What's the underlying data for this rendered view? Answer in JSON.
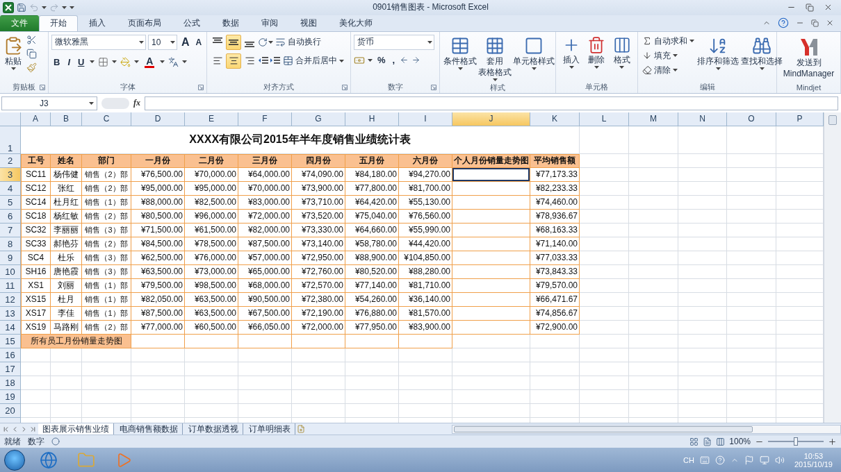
{
  "window": {
    "title": "0901销售图表 - Microsoft Excel"
  },
  "ribbon_tabs": [
    {
      "label": "文件",
      "kind": "file",
      "selected": false
    },
    {
      "label": "开始",
      "kind": "tab",
      "selected": true
    },
    {
      "label": "插入",
      "kind": "tab",
      "selected": false
    },
    {
      "label": "页面布局",
      "kind": "tab",
      "selected": false
    },
    {
      "label": "公式",
      "kind": "tab",
      "selected": false
    },
    {
      "label": "数据",
      "kind": "tab",
      "selected": false
    },
    {
      "label": "审阅",
      "kind": "tab",
      "selected": false
    },
    {
      "label": "视图",
      "kind": "tab",
      "selected": false
    },
    {
      "label": "美化大师",
      "kind": "tab",
      "selected": false
    }
  ],
  "ribbon": {
    "clipboard": {
      "label": "剪贴板",
      "paste": "粘贴"
    },
    "font": {
      "label": "字体",
      "font_name": "微软雅黑",
      "font_size": "10",
      "grow": "A",
      "shrink": "A",
      "bold": "B",
      "italic": "I",
      "underline": "U",
      "font_color": "A"
    },
    "alignment": {
      "label": "对齐方式",
      "vertical": [
        {
          "selected": false
        },
        {
          "selected": true
        },
        {
          "selected": false
        }
      ],
      "horizontal": [
        {
          "selected": false
        },
        {
          "selected": true
        },
        {
          "selected": false
        }
      ],
      "wrap_text": "自动换行",
      "merge_center": "合并后居中"
    },
    "number": {
      "label": "数字",
      "format": "货币",
      "percent": "%",
      "comma": ","
    },
    "styles": {
      "label": "样式",
      "buttons": [
        {
          "lines": [
            "条件格式"
          ]
        },
        {
          "lines": [
            "套用",
            "表格格式"
          ]
        },
        {
          "lines": [
            "单元格样式"
          ]
        }
      ]
    },
    "cells": {
      "label": "单元格",
      "buttons": [
        {
          "lines": [
            "插入"
          ]
        },
        {
          "lines": [
            "删除"
          ]
        },
        {
          "lines": [
            "格式"
          ]
        }
      ]
    },
    "editing": {
      "label": "编辑",
      "small": [
        "自动求和",
        "填充",
        "清除"
      ],
      "large": [
        {
          "lines": [
            "排序和筛选"
          ]
        },
        {
          "lines": [
            "查找和选择"
          ]
        }
      ]
    },
    "mindjet": {
      "label": "Mindjet",
      "lines": [
        "发送到",
        "MindManager"
      ]
    }
  },
  "formula_bar": {
    "name_box": "J3",
    "function_label": "fx"
  },
  "sheet": {
    "columns": [
      {
        "label": "A",
        "selected": false
      },
      {
        "label": "B",
        "selected": false
      },
      {
        "label": "C",
        "selected": false
      },
      {
        "label": "D",
        "selected": false
      },
      {
        "label": "E",
        "selected": false
      },
      {
        "label": "F",
        "selected": false
      },
      {
        "label": "G",
        "selected": false
      },
      {
        "label": "H",
        "selected": false
      },
      {
        "label": "I",
        "selected": false
      },
      {
        "label": "J",
        "selected": true
      },
      {
        "label": "K",
        "selected": false
      },
      {
        "label": "L",
        "selected": false
      },
      {
        "label": "M",
        "selected": false
      },
      {
        "label": "N",
        "selected": false
      },
      {
        "label": "O",
        "selected": false
      },
      {
        "label": "P",
        "selected": false
      }
    ],
    "row_numbers": [
      {
        "label": "1",
        "selected": false
      },
      {
        "label": "2",
        "selected": false
      },
      {
        "label": "3",
        "selected": true
      },
      {
        "label": "4",
        "selected": false
      },
      {
        "label": "5",
        "selected": false
      },
      {
        "label": "6",
        "selected": false
      },
      {
        "label": "7",
        "selected": false
      },
      {
        "label": "8",
        "selected": false
      },
      {
        "label": "9",
        "selected": false
      },
      {
        "label": "10",
        "selected": false
      },
      {
        "label": "11",
        "selected": false
      },
      {
        "label": "12",
        "selected": false
      },
      {
        "label": "13",
        "selected": false
      },
      {
        "label": "14",
        "selected": false
      },
      {
        "label": "15",
        "selected": false
      },
      {
        "label": "16",
        "selected": false
      },
      {
        "label": "17",
        "selected": false
      },
      {
        "label": "18",
        "selected": false
      },
      {
        "label": "19",
        "selected": false
      },
      {
        "label": "20",
        "selected": false
      }
    ],
    "title": "XXXX有限公司2015年半年度销售业绩统计表",
    "header": [
      "工号",
      "姓名",
      "部门",
      "一月份",
      "二月份",
      "三月份",
      "四月份",
      "五月份",
      "六月份",
      "个人月份销量走势图",
      "平均销售额"
    ],
    "rows": [
      {
        "id": "SC11",
        "name": "杨伟健",
        "dept": "销售（2）部",
        "months": [
          "¥76,500.00",
          "¥70,000.00",
          "¥64,000.00",
          "¥74,090.00",
          "¥84,180.00",
          "¥94,270.00"
        ],
        "trend_selected": true,
        "average": "¥77,173.33"
      },
      {
        "id": "SC12",
        "name": "张红",
        "dept": "销售（2）部",
        "months": [
          "¥95,000.00",
          "¥95,000.00",
          "¥70,000.00",
          "¥73,900.00",
          "¥77,800.00",
          "¥81,700.00"
        ],
        "trend_selected": false,
        "average": "¥82,233.33"
      },
      {
        "id": "SC14",
        "name": "杜月红",
        "dept": "销售（1）部",
        "months": [
          "¥88,000.00",
          "¥82,500.00",
          "¥83,000.00",
          "¥73,710.00",
          "¥64,420.00",
          "¥55,130.00"
        ],
        "trend_selected": false,
        "average": "¥74,460.00"
      },
      {
        "id": "SC18",
        "name": "杨红敏",
        "dept": "销售（2）部",
        "months": [
          "¥80,500.00",
          "¥96,000.00",
          "¥72,000.00",
          "¥73,520.00",
          "¥75,040.00",
          "¥76,560.00"
        ],
        "trend_selected": false,
        "average": "¥78,936.67"
      },
      {
        "id": "SC32",
        "name": "李丽丽",
        "dept": "销售（3）部",
        "months": [
          "¥71,500.00",
          "¥61,500.00",
          "¥82,000.00",
          "¥73,330.00",
          "¥64,660.00",
          "¥55,990.00"
        ],
        "trend_selected": false,
        "average": "¥68,163.33"
      },
      {
        "id": "SC33",
        "name": "郝艳芬",
        "dept": "销售（2）部",
        "months": [
          "¥84,500.00",
          "¥78,500.00",
          "¥87,500.00",
          "¥73,140.00",
          "¥58,780.00",
          "¥44,420.00"
        ],
        "trend_selected": false,
        "average": "¥71,140.00"
      },
      {
        "id": "SC4",
        "name": "杜乐",
        "dept": "销售（3）部",
        "months": [
          "¥62,500.00",
          "¥76,000.00",
          "¥57,000.00",
          "¥72,950.00",
          "¥88,900.00",
          "¥104,850.00"
        ],
        "trend_selected": false,
        "average": "¥77,033.33"
      },
      {
        "id": "SH16",
        "name": "唐艳霞",
        "dept": "销售（3）部",
        "months": [
          "¥63,500.00",
          "¥73,000.00",
          "¥65,000.00",
          "¥72,760.00",
          "¥80,520.00",
          "¥88,280.00"
        ],
        "trend_selected": false,
        "average": "¥73,843.33"
      },
      {
        "id": "XS1",
        "name": "刘丽",
        "dept": "销售（1）部",
        "months": [
          "¥79,500.00",
          "¥98,500.00",
          "¥68,000.00",
          "¥72,570.00",
          "¥77,140.00",
          "¥81,710.00"
        ],
        "trend_selected": false,
        "average": "¥79,570.00"
      },
      {
        "id": "XS15",
        "name": "杜月",
        "dept": "销售（1）部",
        "months": [
          "¥82,050.00",
          "¥63,500.00",
          "¥90,500.00",
          "¥72,380.00",
          "¥54,260.00",
          "¥36,140.00"
        ],
        "trend_selected": false,
        "average": "¥66,471.67"
      },
      {
        "id": "XS17",
        "name": "李佳",
        "dept": "销售（1）部",
        "months": [
          "¥87,500.00",
          "¥63,500.00",
          "¥67,500.00",
          "¥72,190.00",
          "¥76,880.00",
          "¥81,570.00"
        ],
        "trend_selected": false,
        "average": "¥74,856.67"
      },
      {
        "id": "XS19",
        "name": "马路刚",
        "dept": "销售（2）部",
        "months": [
          "¥77,000.00",
          "¥60,500.00",
          "¥66,050.00",
          "¥72,000.00",
          "¥77,950.00",
          "¥83,900.00"
        ],
        "trend_selected": false,
        "average": "¥72,900.00"
      }
    ],
    "footer_label": "所有员工月份销量走势图"
  },
  "sheet_tabs": [
    {
      "label": "图表展示销售业绩",
      "selected": true
    },
    {
      "label": "电商销售额数据",
      "selected": false
    },
    {
      "label": "订单数据透视",
      "selected": false
    },
    {
      "label": "订单明细表",
      "selected": false
    }
  ],
  "status_bar": {
    "ready": "就绪",
    "mode": "数字",
    "zoom": "100%",
    "zoom_slider": {
      "level": 0.5
    }
  },
  "taskbar": {
    "language": "CH",
    "time": "10:53",
    "date": "2015/10/19"
  }
}
